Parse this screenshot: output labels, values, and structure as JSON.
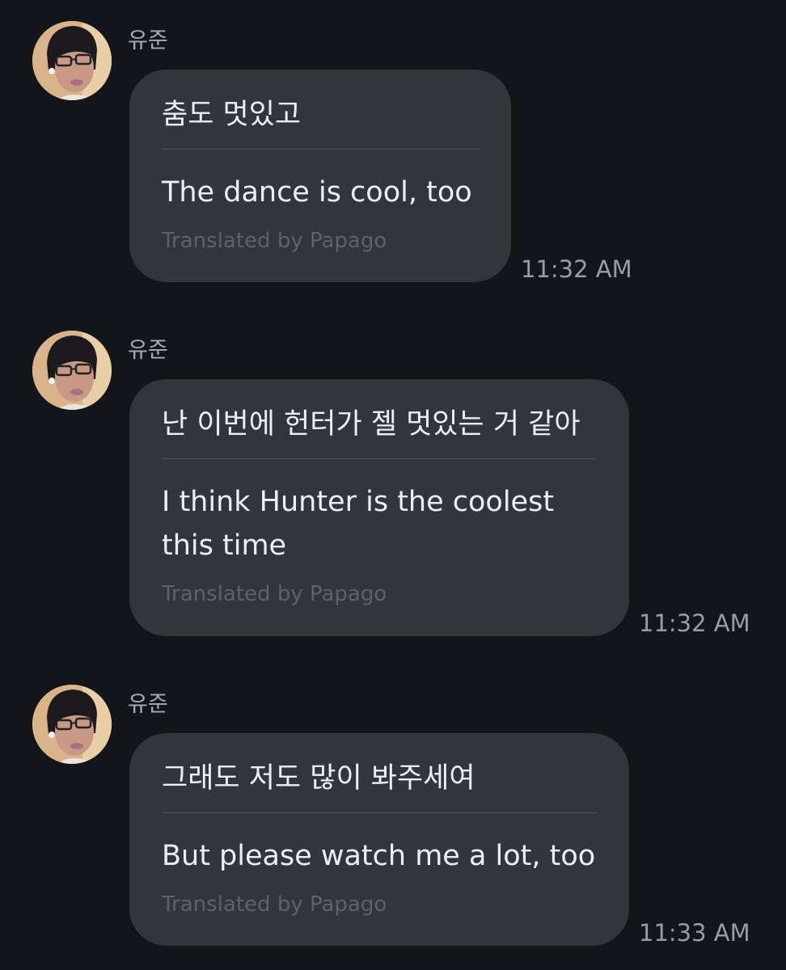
{
  "messages": [
    {
      "sender": "유준",
      "original": "춤도 멋있고",
      "translation": "The dance is cool, too",
      "credit": "Translated by Papago",
      "time": "11:32 AM"
    },
    {
      "sender": "유준",
      "original": "난 이번에 헌터가 젤 멋있는 거 같아",
      "translation": "I think Hunter is the coolest this time",
      "credit": "Translated by Papago",
      "time": "11:32 AM"
    },
    {
      "sender": "유준",
      "original": "그래도 저도 많이 봐주세여",
      "translation": "But please watch me a lot, too",
      "credit": "Translated by Papago",
      "time": "11:33 AM"
    }
  ]
}
